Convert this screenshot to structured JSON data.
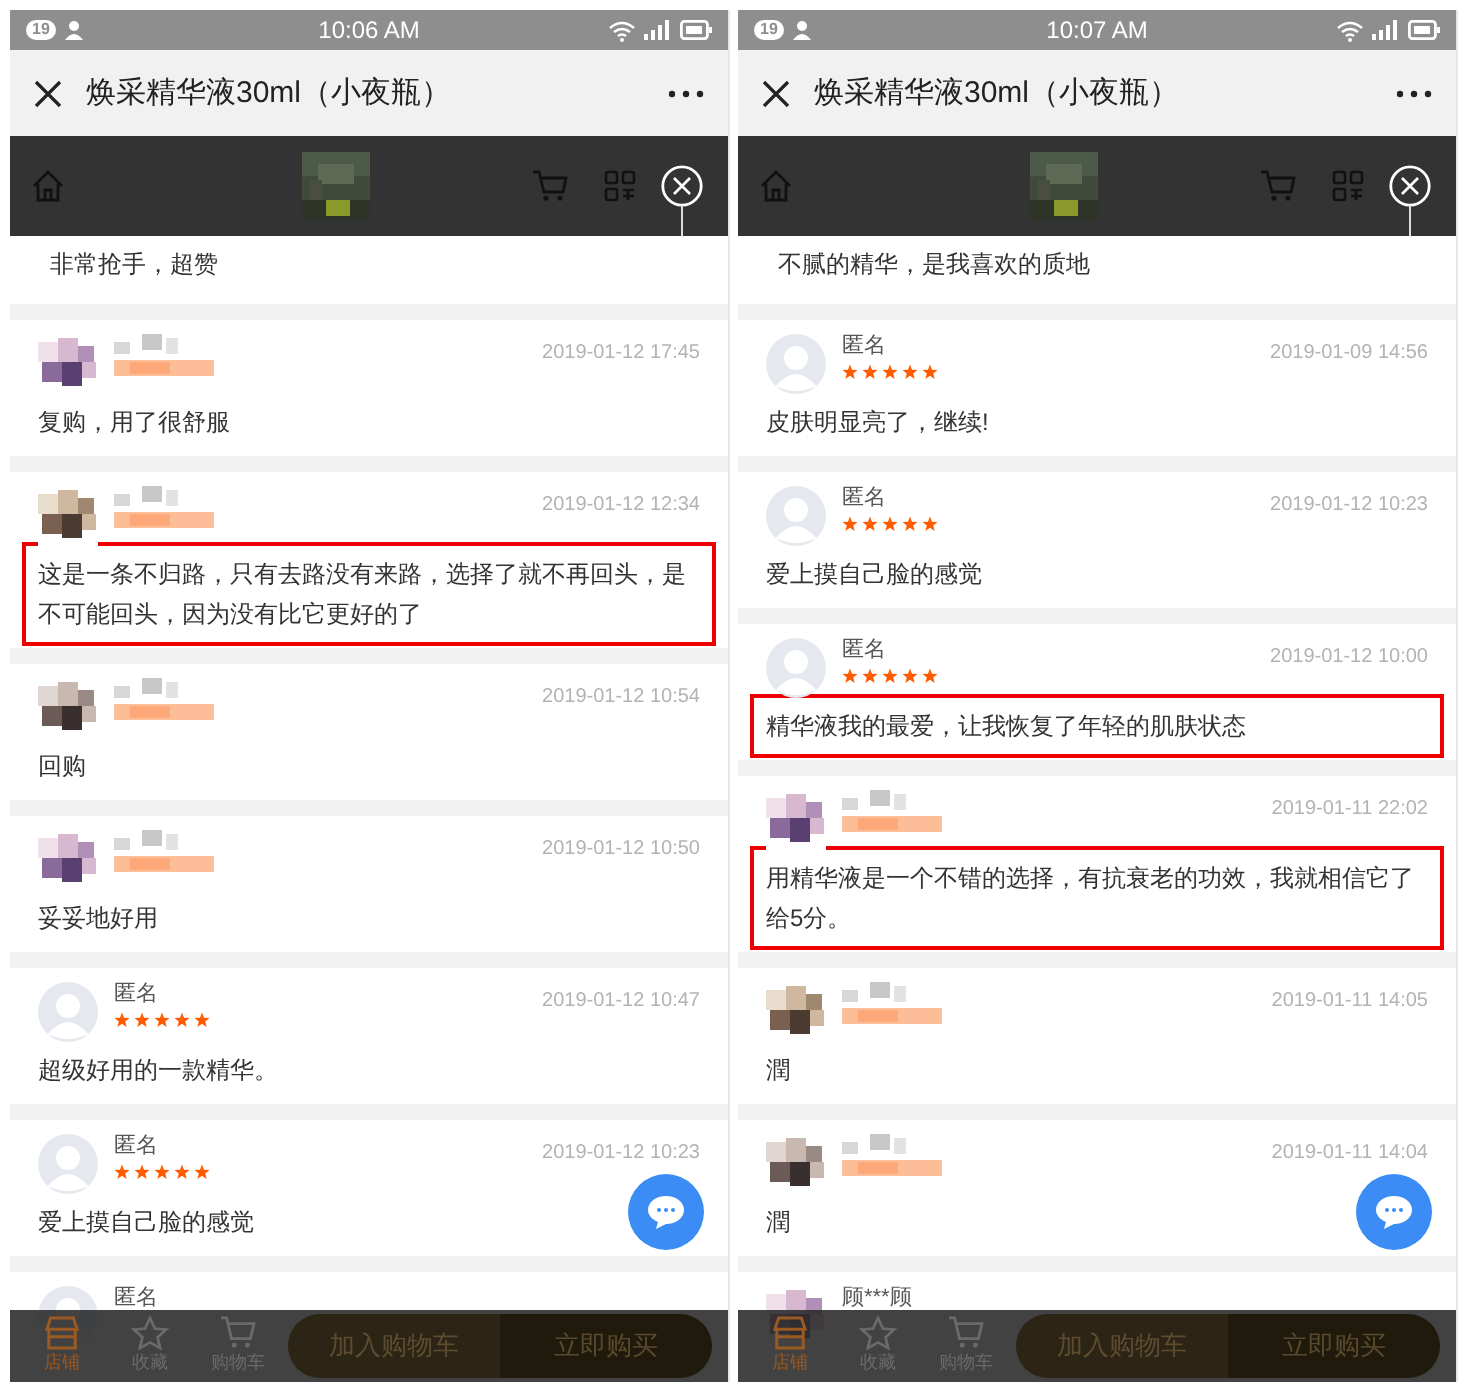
{
  "panels": [
    {
      "status_bar": {
        "badge": "19",
        "time": "10:06 AM"
      },
      "title": "焕采精华液30ml（小夜瓶）",
      "reviews": [
        {
          "kind": "partial",
          "text": "非常抢手，超赞"
        },
        {
          "kind": "blurred",
          "date": "2019-01-12 17:45",
          "text": "复购，用了很舒服",
          "highlighted": false
        },
        {
          "kind": "blurred",
          "date": "2019-01-12 12:34",
          "text": "这是一条不归路，只有去路没有来路，选择了就不再回头，是不可能回头，因为没有比它更好的了",
          "highlighted": true
        },
        {
          "kind": "blurred",
          "date": "2019-01-12 10:54",
          "text": "回购",
          "highlighted": false
        },
        {
          "kind": "blurred",
          "date": "2019-01-12 10:50",
          "text": "妥妥地好用",
          "highlighted": false
        },
        {
          "kind": "anonymous",
          "name": "匿名",
          "stars": 5,
          "date": "2019-01-12 10:47",
          "text": "超级好用的一款精华。",
          "highlighted": false
        },
        {
          "kind": "anonymous",
          "name": "匿名",
          "stars": 5,
          "date": "2019-01-12 10:23",
          "text": "爱上摸自己脸的感觉",
          "highlighted": false
        },
        {
          "kind": "anonymous",
          "name": "匿名"
        }
      ],
      "bottom_bar": {
        "tabs": [
          {
            "label": "店铺",
            "active": true
          },
          {
            "label": "收藏",
            "active": false
          },
          {
            "label": "购物车",
            "active": false
          }
        ],
        "buttons": [
          "加入购物车",
          "立即购买"
        ]
      }
    },
    {
      "status_bar": {
        "badge": "19",
        "time": "10:07 AM"
      },
      "title": "焕采精华液30ml（小夜瓶）",
      "reviews": [
        {
          "kind": "partial",
          "text": "不腻的精华，是我喜欢的质地"
        },
        {
          "kind": "anonymous",
          "name": "匿名",
          "stars": 5,
          "date": "2019-01-09 14:56",
          "text": "皮肤明显亮了，继续!",
          "highlighted": false
        },
        {
          "kind": "anonymous",
          "name": "匿名",
          "stars": 5,
          "date": "2019-01-12 10:23",
          "text": "爱上摸自己脸的感觉",
          "highlighted": false
        },
        {
          "kind": "anonymous",
          "name": "匿名",
          "stars": 5,
          "date": "2019-01-12 10:00",
          "text": "精华液我的最爱，让我恢复了年轻的肌肤状态",
          "highlighted": true
        },
        {
          "kind": "blurred",
          "date": "2019-01-11 22:02",
          "text": "用精华液是一个不错的选择，有抗衰老的功效，我就相信它了给5分。",
          "highlighted": true
        },
        {
          "kind": "blurred",
          "date": "2019-01-11 14:05",
          "text": "潤",
          "highlighted": false
        },
        {
          "kind": "blurred",
          "date": "2019-01-11 14:04",
          "text": "潤",
          "highlighted": false
        },
        {
          "kind": "blurred",
          "name": "顾***顾"
        }
      ],
      "bottom_bar": {
        "tabs": [
          {
            "label": "店铺",
            "active": true
          },
          {
            "label": "收藏",
            "active": false
          },
          {
            "label": "购物车",
            "active": false
          }
        ],
        "buttons": [
          "加入购物车",
          "立即购买"
        ]
      }
    }
  ]
}
